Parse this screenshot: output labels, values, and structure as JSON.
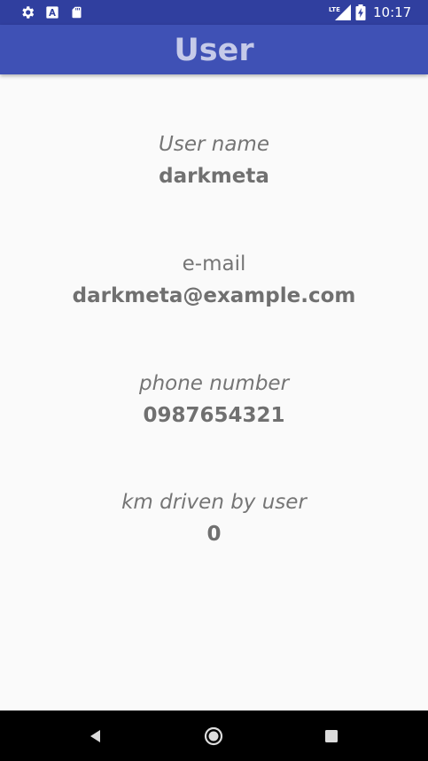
{
  "status_bar": {
    "time": "10:17",
    "network": "LTE",
    "icons": [
      "gear-icon",
      "a-notification-icon",
      "sd-card-icon",
      "lte-signal-icon",
      "battery-charging-icon"
    ],
    "background_color": "#303f9f"
  },
  "app_bar": {
    "title": "User",
    "background_color": "#3f51b5",
    "title_color": "#c5cae9"
  },
  "profile": {
    "username": {
      "label": "User name",
      "value": "darkmeta"
    },
    "email": {
      "label": "e-mail",
      "value": "darkmeta@example.com"
    },
    "phone": {
      "label": "phone number",
      "value": "0987654321"
    },
    "km_driven": {
      "label": "km driven by user",
      "value": "0"
    }
  },
  "nav_bar": {
    "buttons": [
      "back-icon",
      "home-icon",
      "recents-icon"
    ]
  }
}
